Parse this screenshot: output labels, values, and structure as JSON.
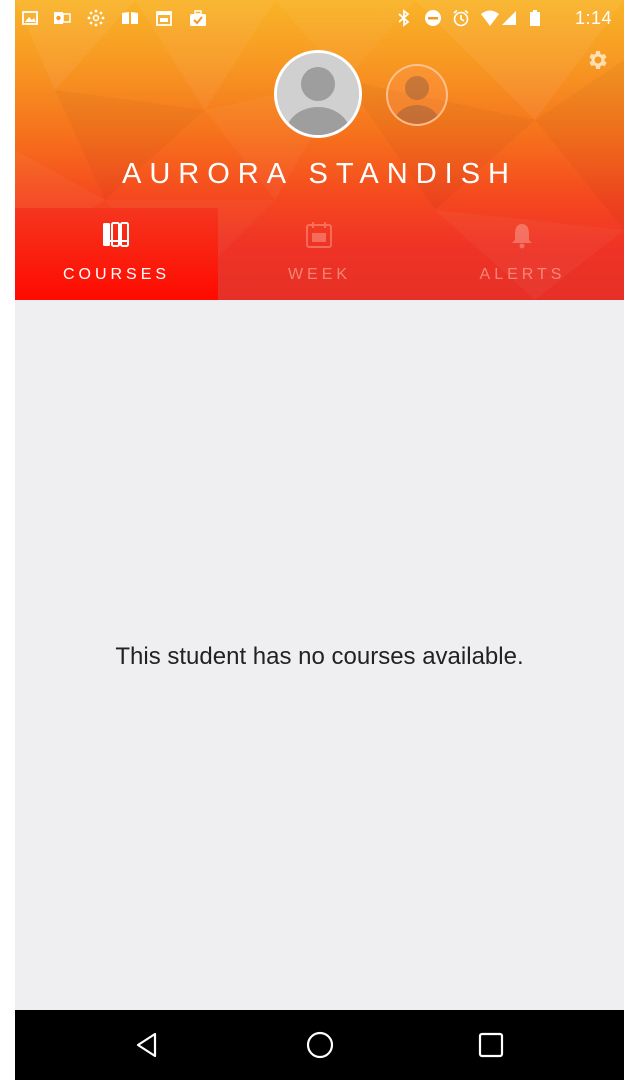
{
  "status_bar": {
    "time": "1:14",
    "left_icons": [
      "image-icon",
      "outlook-icon",
      "canvas-icon",
      "book-icon",
      "calendar-icon",
      "briefcase-check-icon"
    ],
    "right_icons": [
      "bluetooth-icon",
      "do-not-disturb-icon",
      "alarm-icon",
      "wifi-icon",
      "signal-icon",
      "battery-icon"
    ]
  },
  "profile": {
    "student_name": "AURORA STANDISH"
  },
  "tabs": [
    {
      "label": "COURSES",
      "icon": "courses-icon",
      "active": true
    },
    {
      "label": "WEEK",
      "icon": "calendar-week-icon",
      "active": false
    },
    {
      "label": "ALERTS",
      "icon": "bell-icon",
      "active": false
    }
  ],
  "main": {
    "empty_message": "This student has no courses available."
  },
  "colors": {
    "header_top": "#f9b428",
    "header_bottom": "#e63027",
    "active_tab": "#ff0a00",
    "background": "#efeff1",
    "navbar": "#000000"
  }
}
